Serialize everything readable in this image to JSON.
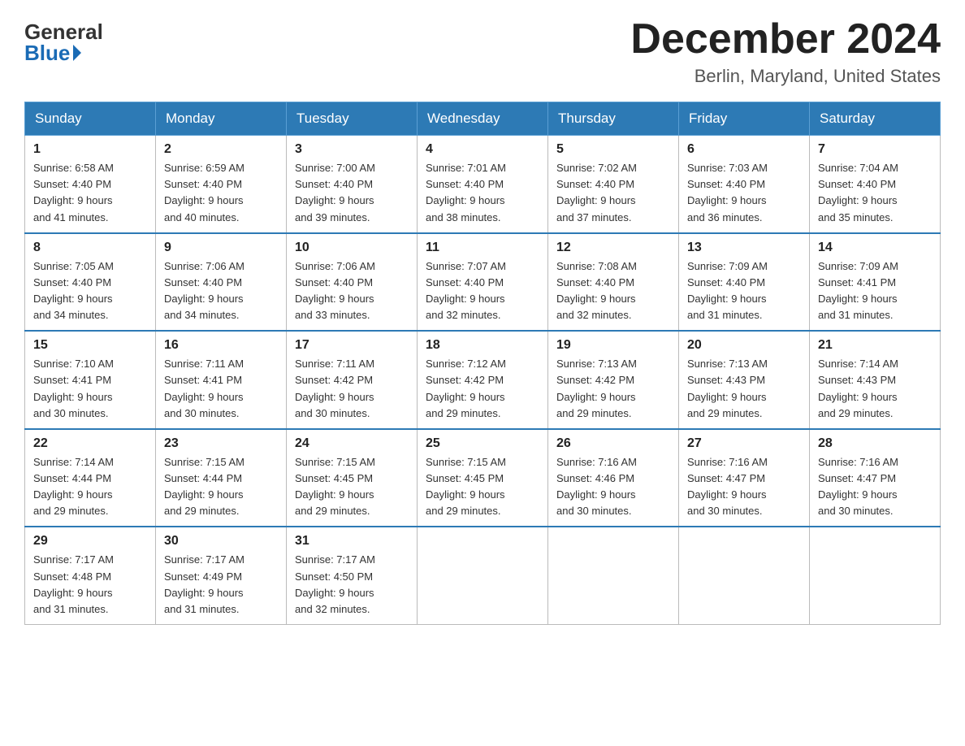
{
  "header": {
    "logo_general": "General",
    "logo_blue": "Blue",
    "month_title": "December 2024",
    "location": "Berlin, Maryland, United States"
  },
  "days_of_week": [
    "Sunday",
    "Monday",
    "Tuesday",
    "Wednesday",
    "Thursday",
    "Friday",
    "Saturday"
  ],
  "weeks": [
    [
      {
        "day": 1,
        "sunrise": "6:58 AM",
        "sunset": "4:40 PM",
        "daylight": "9 hours and 41 minutes."
      },
      {
        "day": 2,
        "sunrise": "6:59 AM",
        "sunset": "4:40 PM",
        "daylight": "9 hours and 40 minutes."
      },
      {
        "day": 3,
        "sunrise": "7:00 AM",
        "sunset": "4:40 PM",
        "daylight": "9 hours and 39 minutes."
      },
      {
        "day": 4,
        "sunrise": "7:01 AM",
        "sunset": "4:40 PM",
        "daylight": "9 hours and 38 minutes."
      },
      {
        "day": 5,
        "sunrise": "7:02 AM",
        "sunset": "4:40 PM",
        "daylight": "9 hours and 37 minutes."
      },
      {
        "day": 6,
        "sunrise": "7:03 AM",
        "sunset": "4:40 PM",
        "daylight": "9 hours and 36 minutes."
      },
      {
        "day": 7,
        "sunrise": "7:04 AM",
        "sunset": "4:40 PM",
        "daylight": "9 hours and 35 minutes."
      }
    ],
    [
      {
        "day": 8,
        "sunrise": "7:05 AM",
        "sunset": "4:40 PM",
        "daylight": "9 hours and 34 minutes."
      },
      {
        "day": 9,
        "sunrise": "7:06 AM",
        "sunset": "4:40 PM",
        "daylight": "9 hours and 34 minutes."
      },
      {
        "day": 10,
        "sunrise": "7:06 AM",
        "sunset": "4:40 PM",
        "daylight": "9 hours and 33 minutes."
      },
      {
        "day": 11,
        "sunrise": "7:07 AM",
        "sunset": "4:40 PM",
        "daylight": "9 hours and 32 minutes."
      },
      {
        "day": 12,
        "sunrise": "7:08 AM",
        "sunset": "4:40 PM",
        "daylight": "9 hours and 32 minutes."
      },
      {
        "day": 13,
        "sunrise": "7:09 AM",
        "sunset": "4:40 PM",
        "daylight": "9 hours and 31 minutes."
      },
      {
        "day": 14,
        "sunrise": "7:09 AM",
        "sunset": "4:41 PM",
        "daylight": "9 hours and 31 minutes."
      }
    ],
    [
      {
        "day": 15,
        "sunrise": "7:10 AM",
        "sunset": "4:41 PM",
        "daylight": "9 hours and 30 minutes."
      },
      {
        "day": 16,
        "sunrise": "7:11 AM",
        "sunset": "4:41 PM",
        "daylight": "9 hours and 30 minutes."
      },
      {
        "day": 17,
        "sunrise": "7:11 AM",
        "sunset": "4:42 PM",
        "daylight": "9 hours and 30 minutes."
      },
      {
        "day": 18,
        "sunrise": "7:12 AM",
        "sunset": "4:42 PM",
        "daylight": "9 hours and 29 minutes."
      },
      {
        "day": 19,
        "sunrise": "7:13 AM",
        "sunset": "4:42 PM",
        "daylight": "9 hours and 29 minutes."
      },
      {
        "day": 20,
        "sunrise": "7:13 AM",
        "sunset": "4:43 PM",
        "daylight": "9 hours and 29 minutes."
      },
      {
        "day": 21,
        "sunrise": "7:14 AM",
        "sunset": "4:43 PM",
        "daylight": "9 hours and 29 minutes."
      }
    ],
    [
      {
        "day": 22,
        "sunrise": "7:14 AM",
        "sunset": "4:44 PM",
        "daylight": "9 hours and 29 minutes."
      },
      {
        "day": 23,
        "sunrise": "7:15 AM",
        "sunset": "4:44 PM",
        "daylight": "9 hours and 29 minutes."
      },
      {
        "day": 24,
        "sunrise": "7:15 AM",
        "sunset": "4:45 PM",
        "daylight": "9 hours and 29 minutes."
      },
      {
        "day": 25,
        "sunrise": "7:15 AM",
        "sunset": "4:45 PM",
        "daylight": "9 hours and 29 minutes."
      },
      {
        "day": 26,
        "sunrise": "7:16 AM",
        "sunset": "4:46 PM",
        "daylight": "9 hours and 30 minutes."
      },
      {
        "day": 27,
        "sunrise": "7:16 AM",
        "sunset": "4:47 PM",
        "daylight": "9 hours and 30 minutes."
      },
      {
        "day": 28,
        "sunrise": "7:16 AM",
        "sunset": "4:47 PM",
        "daylight": "9 hours and 30 minutes."
      }
    ],
    [
      {
        "day": 29,
        "sunrise": "7:17 AM",
        "sunset": "4:48 PM",
        "daylight": "9 hours and 31 minutes."
      },
      {
        "day": 30,
        "sunrise": "7:17 AM",
        "sunset": "4:49 PM",
        "daylight": "9 hours and 31 minutes."
      },
      {
        "day": 31,
        "sunrise": "7:17 AM",
        "sunset": "4:50 PM",
        "daylight": "9 hours and 32 minutes."
      },
      null,
      null,
      null,
      null
    ]
  ]
}
